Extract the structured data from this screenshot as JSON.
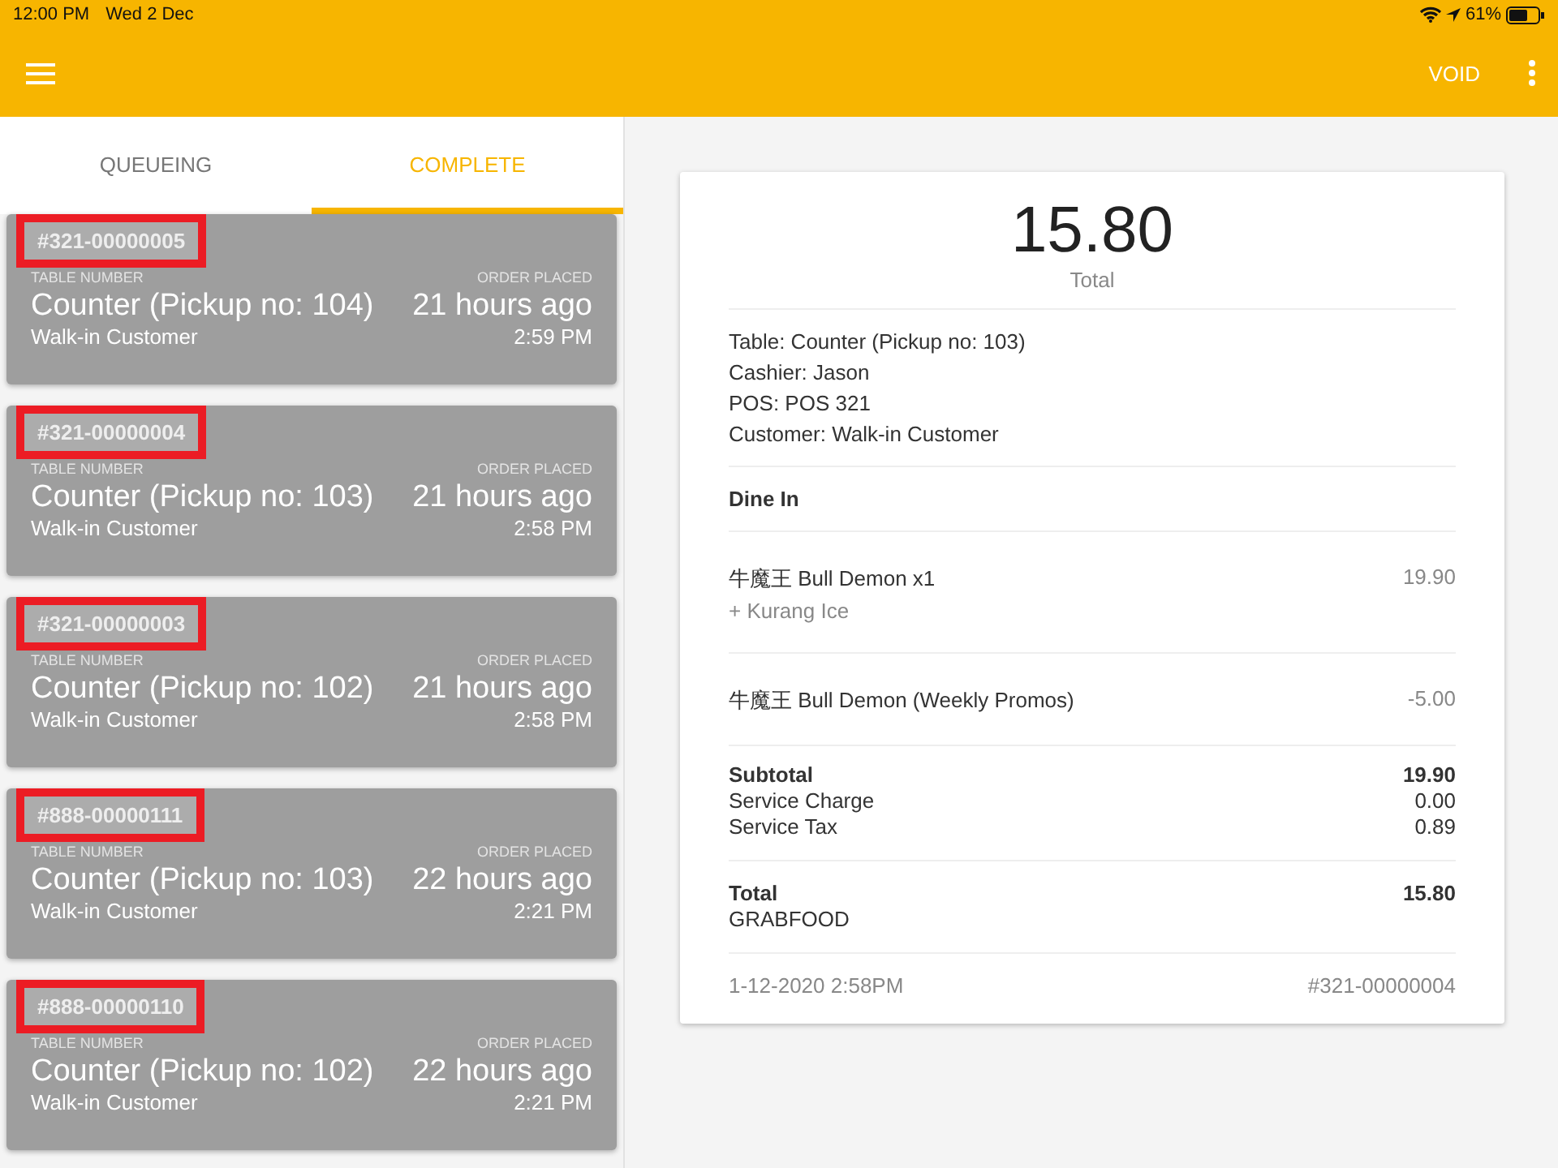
{
  "status_bar": {
    "time": "12:00 PM",
    "date": "Wed 2 Dec",
    "battery": "61%"
  },
  "app_bar": {
    "action": "VOID"
  },
  "tabs": [
    {
      "label": "QUEUEING",
      "selected": false
    },
    {
      "label": "COMPLETE",
      "selected": true
    }
  ],
  "orders": [
    {
      "number": "#321-00000005",
      "highlighted": true,
      "table_label": "TABLE NUMBER",
      "placed_label": "ORDER PLACED",
      "table": "Counter (Pickup no: 104)",
      "ago": "21 hours ago",
      "customer": "Walk-in Customer",
      "time": "2:59 PM"
    },
    {
      "number": "#321-00000004",
      "highlighted": true,
      "table_label": "TABLE NUMBER",
      "placed_label": "ORDER PLACED",
      "table": "Counter (Pickup no: 103)",
      "ago": "21 hours ago",
      "customer": "Walk-in Customer",
      "time": "2:58 PM"
    },
    {
      "number": "#321-00000003",
      "highlighted": true,
      "table_label": "TABLE NUMBER",
      "placed_label": "ORDER PLACED",
      "table": "Counter (Pickup no: 102)",
      "ago": "21 hours ago",
      "customer": "Walk-in Customer",
      "time": "2:58 PM"
    },
    {
      "number": "#888-00000111",
      "highlighted": true,
      "table_label": "TABLE NUMBER",
      "placed_label": "ORDER PLACED",
      "table": "Counter (Pickup no: 103)",
      "ago": "22 hours ago",
      "customer": "Walk-in Customer",
      "time": "2:21 PM"
    },
    {
      "number": "#888-00000110",
      "highlighted": true,
      "table_label": "TABLE NUMBER",
      "placed_label": "ORDER PLACED",
      "table": "Counter (Pickup no: 102)",
      "ago": "22 hours ago",
      "customer": "Walk-in Customer",
      "time": "2:21 PM"
    }
  ],
  "receipt": {
    "amount": "15.80",
    "amount_label": "Total",
    "info": [
      "Table: Counter (Pickup no: 103)",
      "Cashier: Jason",
      "POS: POS 321",
      "Customer: Walk-in Customer"
    ],
    "order_type": "Dine In",
    "items": [
      {
        "name": "牛魔王 Bull Demon x1",
        "modifier": "+ Kurang Ice",
        "price": "19.90"
      },
      {
        "name": "牛魔王 Bull Demon (Weekly Promos)",
        "price": "-5.00"
      }
    ],
    "summary": [
      {
        "label": "Subtotal",
        "value": "19.90",
        "bold": true
      },
      {
        "label": "Service Charge",
        "value": "0.00",
        "bold": false
      },
      {
        "label": "Service Tax",
        "value": "0.89",
        "bold": false
      }
    ],
    "total": {
      "label": "Total",
      "value": "15.80",
      "method": "GRABFOOD"
    },
    "footer": {
      "date": "1-12-2020 2:58PM",
      "number": "#321-00000004"
    }
  }
}
